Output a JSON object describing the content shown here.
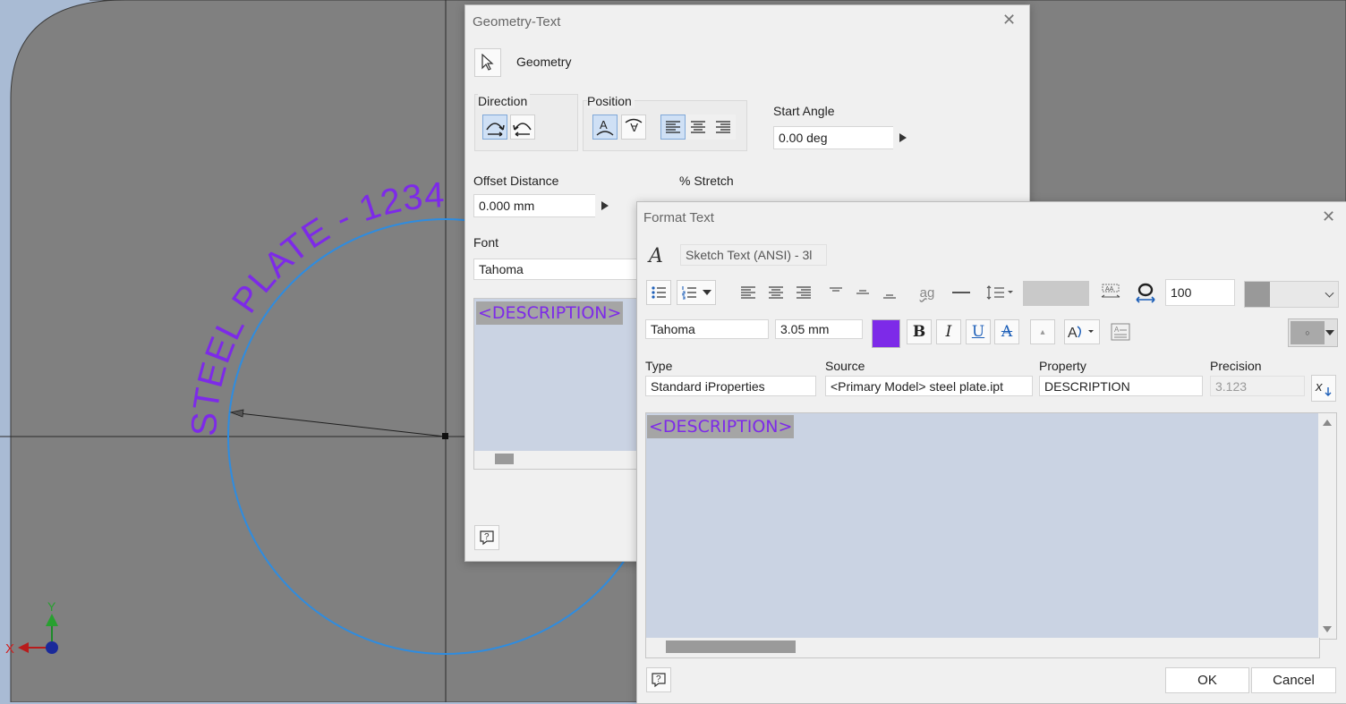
{
  "colors": {
    "text_accent": "#7d2ae8",
    "circle": "#2e8ce0",
    "plate": "#808080",
    "background": "#a9bbd4",
    "highlight": "#a5a5a5"
  },
  "canvas": {
    "arc_text": "STEEL PLATE - 1234",
    "axis_x": "X",
    "axis_y": "Y"
  },
  "geometry_text": {
    "title": "Geometry-Text",
    "geometry_label": "Geometry",
    "direction_label": "Direction",
    "position_label": "Position",
    "start_angle_label": "Start Angle",
    "start_angle_value": "0.00 deg",
    "offset_distance_label": "Offset Distance",
    "offset_distance_value": "0.000 mm",
    "stretch_label": "% Stretch",
    "font_label": "Font",
    "font_value": "Tahoma",
    "description_token": "<DESCRIPTION>"
  },
  "format_text": {
    "title": "Format Text",
    "style_value": "Sketch Text (ANSI) - 3l",
    "stretch_value": "100",
    "font_value": "Tahoma",
    "size_value": "3.05 mm",
    "type_label": "Type",
    "type_value": "Standard iProperties",
    "source_label": "Source",
    "source_value": "<Primary Model> steel plate.ipt",
    "property_label": "Property",
    "property_value": "DESCRIPTION",
    "precision_label": "Precision",
    "precision_value": "3.123",
    "description_token": "<DESCRIPTION>",
    "ok_label": "OK",
    "cancel_label": "Cancel",
    "bold_glyph": "B",
    "italic_glyph": "I",
    "underline_glyph": "U",
    "strike_glyph": "A"
  }
}
